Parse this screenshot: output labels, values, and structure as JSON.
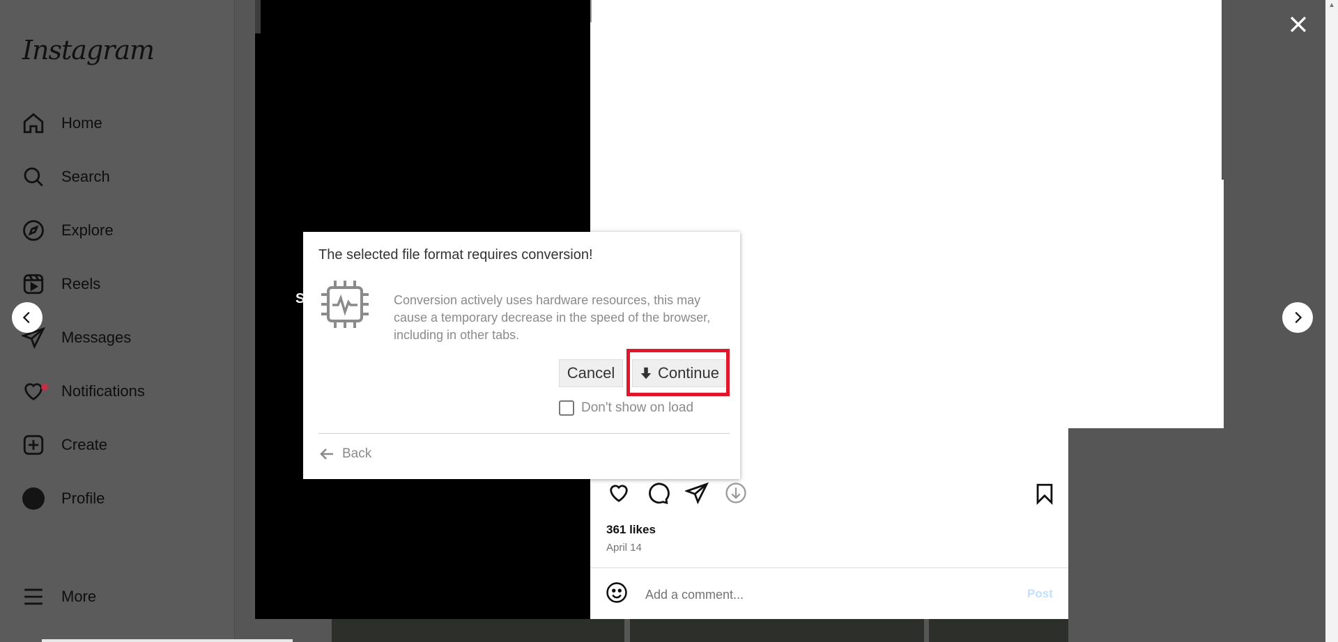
{
  "sidebar": {
    "logo": "Instagram",
    "items": [
      {
        "label": "Home",
        "icon": "home-icon"
      },
      {
        "label": "Search",
        "icon": "search-icon"
      },
      {
        "label": "Explore",
        "icon": "compass-icon"
      },
      {
        "label": "Reels",
        "icon": "reels-icon"
      },
      {
        "label": "Messages",
        "icon": "send-icon"
      },
      {
        "label": "Notifications",
        "icon": "heart-icon"
      },
      {
        "label": "Create",
        "icon": "plus-square-icon"
      },
      {
        "label": "Profile",
        "icon": "avatar"
      },
      {
        "label": "More",
        "icon": "menu-icon"
      }
    ]
  },
  "post": {
    "media_letter": "S",
    "likes": "361 likes",
    "date": "April 14",
    "comment_placeholder": "Add a comment...",
    "post_label": "Post",
    "under_caption": "..."
  },
  "dialog": {
    "title": "The selected file format requires conversion!",
    "body": "Conversion actively uses hardware resources, this may cause a temporary decrease in the speed of the browser, including in other tabs.",
    "cancel_label": "Cancel",
    "continue_label": "Continue",
    "checkbox_label": "Don't show on load",
    "back_label": "Back"
  },
  "colors": {
    "highlight": "#e0162b",
    "overlay": "#565656",
    "notification_dot": "#c23043"
  }
}
